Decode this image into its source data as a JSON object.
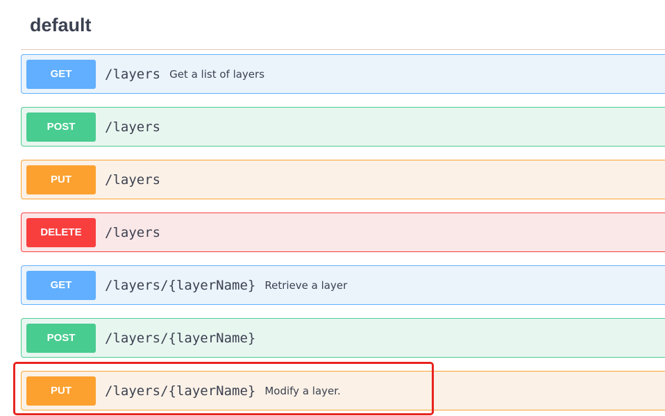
{
  "section": {
    "title": "default"
  },
  "colors": {
    "get": "#61affe",
    "post": "#49cc90",
    "put": "#fca130",
    "delete": "#f93e3e",
    "highlight": "#e8231f"
  },
  "operations": [
    {
      "method": "GET",
      "path": "/layers",
      "summary": "Get a list of layers"
    },
    {
      "method": "POST",
      "path": "/layers",
      "summary": ""
    },
    {
      "method": "PUT",
      "path": "/layers",
      "summary": ""
    },
    {
      "method": "DELETE",
      "path": "/layers",
      "summary": ""
    },
    {
      "method": "GET",
      "path": "/layers/{layerName}",
      "summary": "Retrieve a layer"
    },
    {
      "method": "POST",
      "path": "/layers/{layerName}",
      "summary": ""
    },
    {
      "method": "PUT",
      "path": "/layers/{layerName}",
      "summary": "Modify a layer."
    }
  ]
}
